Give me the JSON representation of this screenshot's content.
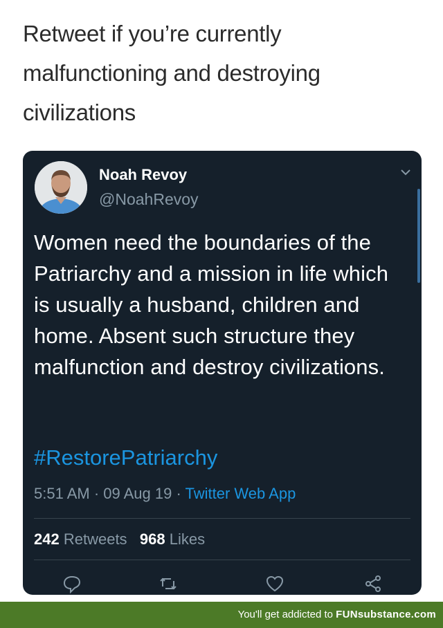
{
  "caption": "Retweet if you’re currently malfunctioning and destroying civilizations",
  "tweet": {
    "name": "Noah Revoy",
    "handle": "@NoahRevoy",
    "text": "Women need the boundaries of the Patriarchy and a mission in life which is usually a husband, children and home. Absent such structure they malfunction and destroy civilizations.",
    "hashtag": "#RestorePatriarchy",
    "time": "5:51 AM · 09 Aug 19 · ",
    "source": "Twitter Web App",
    "retweets_count": "242",
    "retweets_label": "Retweets",
    "likes_count": "968",
    "likes_label": "Likes"
  },
  "icons": [
    "chevron-down-icon",
    "reply-icon",
    "retweet-icon",
    "like-icon",
    "share-icon"
  ],
  "colors": {
    "card_bg": "#15202b",
    "link": "#1b95e0",
    "muted": "#8899a6",
    "footer_bg": "#4c7a27"
  },
  "footer": {
    "text": "You'll get addicted to ",
    "brand": "FUNsubstance.com"
  }
}
